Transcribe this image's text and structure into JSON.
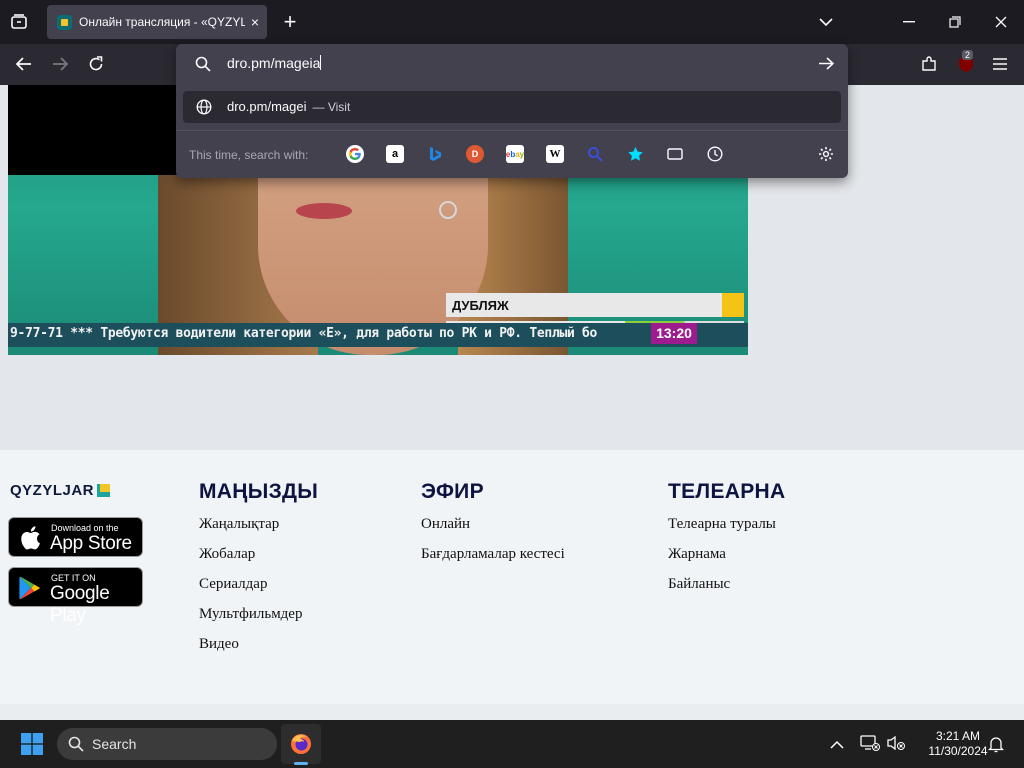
{
  "browser": {
    "tab": {
      "title": "Онлайн трансляция - «QYZYL",
      "close_icon": "×"
    },
    "new_tab_icon": "+",
    "urlbar": {
      "value": "dro.pm/mageia",
      "suggestion_url": "dro.pm/magei",
      "suggestion_sep": "—",
      "suggestion_action": "Visit",
      "onesearch_label": "This time, search with:",
      "engines": [
        "Google",
        "Amazon",
        "Bing",
        "DuckDuckGo",
        "eBay",
        "Wikipedia",
        "Search",
        "Bookmarks",
        "Tabs",
        "History"
      ]
    },
    "extension_badge": "2"
  },
  "video": {
    "lower_third": "ДУБЛЯЖ",
    "ticker": "9-77-71  *** Требуются водители категории «Е», для работы по РК и РФ. Теплый бо",
    "time": "13:20"
  },
  "footer": {
    "logo": "QYZYLJAR",
    "app_store": {
      "small": "Download on the",
      "big": "App Store"
    },
    "google_play": {
      "small": "GET IT ON",
      "big": "Google Play"
    },
    "columns": [
      {
        "title": "МАҢЫЗДЫ",
        "links": [
          "Жаңалықтар",
          "Жобалар",
          "Сериалдар",
          "Мультфильмдер",
          "Видео"
        ]
      },
      {
        "title": "ЭФИР",
        "links": [
          "Онлайн",
          "Бағдарламалар кестесі"
        ]
      },
      {
        "title": "ТЕЛЕАРНА",
        "links": [
          "Телеарна туралы",
          "Жарнама",
          "Байланыс"
        ]
      }
    ]
  },
  "taskbar": {
    "search_label": "Search",
    "time": "3:21 AM",
    "date": "11/30/2024"
  },
  "colors": {
    "accent": "#5fb2f2",
    "brand_teal": "#1aa5a0",
    "brand_yellow": "#f4c526",
    "ticker_badge": "#9c1c8f"
  }
}
